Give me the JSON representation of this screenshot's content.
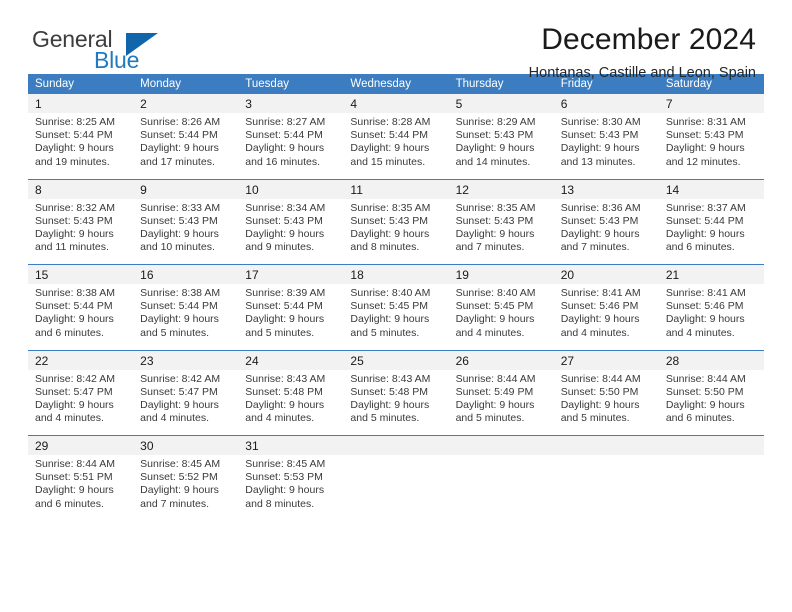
{
  "brand": {
    "name_part1": "General",
    "name_part2": "Blue"
  },
  "header": {
    "title": "December 2024",
    "subtitle": "Hontanas, Castille and Leon, Spain"
  },
  "colors": {
    "header_blue": "#3b7dc0",
    "logo_blue": "#1f7ac0",
    "daynum_bg": "#f2f2f2"
  },
  "weekdays": [
    "Sunday",
    "Monday",
    "Tuesday",
    "Wednesday",
    "Thursday",
    "Friday",
    "Saturday"
  ],
  "weeks": [
    {
      "days": [
        {
          "num": "1",
          "sunrise": "Sunrise: 8:25 AM",
          "sunset": "Sunset: 5:44 PM",
          "daylight1": "Daylight: 9 hours",
          "daylight2": "and 19 minutes."
        },
        {
          "num": "2",
          "sunrise": "Sunrise: 8:26 AM",
          "sunset": "Sunset: 5:44 PM",
          "daylight1": "Daylight: 9 hours",
          "daylight2": "and 17 minutes."
        },
        {
          "num": "3",
          "sunrise": "Sunrise: 8:27 AM",
          "sunset": "Sunset: 5:44 PM",
          "daylight1": "Daylight: 9 hours",
          "daylight2": "and 16 minutes."
        },
        {
          "num": "4",
          "sunrise": "Sunrise: 8:28 AM",
          "sunset": "Sunset: 5:44 PM",
          "daylight1": "Daylight: 9 hours",
          "daylight2": "and 15 minutes."
        },
        {
          "num": "5",
          "sunrise": "Sunrise: 8:29 AM",
          "sunset": "Sunset: 5:43 PM",
          "daylight1": "Daylight: 9 hours",
          "daylight2": "and 14 minutes."
        },
        {
          "num": "6",
          "sunrise": "Sunrise: 8:30 AM",
          "sunset": "Sunset: 5:43 PM",
          "daylight1": "Daylight: 9 hours",
          "daylight2": "and 13 minutes."
        },
        {
          "num": "7",
          "sunrise": "Sunrise: 8:31 AM",
          "sunset": "Sunset: 5:43 PM",
          "daylight1": "Daylight: 9 hours",
          "daylight2": "and 12 minutes."
        }
      ]
    },
    {
      "days": [
        {
          "num": "8",
          "sunrise": "Sunrise: 8:32 AM",
          "sunset": "Sunset: 5:43 PM",
          "daylight1": "Daylight: 9 hours",
          "daylight2": "and 11 minutes."
        },
        {
          "num": "9",
          "sunrise": "Sunrise: 8:33 AM",
          "sunset": "Sunset: 5:43 PM",
          "daylight1": "Daylight: 9 hours",
          "daylight2": "and 10 minutes."
        },
        {
          "num": "10",
          "sunrise": "Sunrise: 8:34 AM",
          "sunset": "Sunset: 5:43 PM",
          "daylight1": "Daylight: 9 hours",
          "daylight2": "and 9 minutes."
        },
        {
          "num": "11",
          "sunrise": "Sunrise: 8:35 AM",
          "sunset": "Sunset: 5:43 PM",
          "daylight1": "Daylight: 9 hours",
          "daylight2": "and 8 minutes."
        },
        {
          "num": "12",
          "sunrise": "Sunrise: 8:35 AM",
          "sunset": "Sunset: 5:43 PM",
          "daylight1": "Daylight: 9 hours",
          "daylight2": "and 7 minutes."
        },
        {
          "num": "13",
          "sunrise": "Sunrise: 8:36 AM",
          "sunset": "Sunset: 5:43 PM",
          "daylight1": "Daylight: 9 hours",
          "daylight2": "and 7 minutes."
        },
        {
          "num": "14",
          "sunrise": "Sunrise: 8:37 AM",
          "sunset": "Sunset: 5:44 PM",
          "daylight1": "Daylight: 9 hours",
          "daylight2": "and 6 minutes."
        }
      ]
    },
    {
      "days": [
        {
          "num": "15",
          "sunrise": "Sunrise: 8:38 AM",
          "sunset": "Sunset: 5:44 PM",
          "daylight1": "Daylight: 9 hours",
          "daylight2": "and 6 minutes."
        },
        {
          "num": "16",
          "sunrise": "Sunrise: 8:38 AM",
          "sunset": "Sunset: 5:44 PM",
          "daylight1": "Daylight: 9 hours",
          "daylight2": "and 5 minutes."
        },
        {
          "num": "17",
          "sunrise": "Sunrise: 8:39 AM",
          "sunset": "Sunset: 5:44 PM",
          "daylight1": "Daylight: 9 hours",
          "daylight2": "and 5 minutes."
        },
        {
          "num": "18",
          "sunrise": "Sunrise: 8:40 AM",
          "sunset": "Sunset: 5:45 PM",
          "daylight1": "Daylight: 9 hours",
          "daylight2": "and 5 minutes."
        },
        {
          "num": "19",
          "sunrise": "Sunrise: 8:40 AM",
          "sunset": "Sunset: 5:45 PM",
          "daylight1": "Daylight: 9 hours",
          "daylight2": "and 4 minutes."
        },
        {
          "num": "20",
          "sunrise": "Sunrise: 8:41 AM",
          "sunset": "Sunset: 5:46 PM",
          "daylight1": "Daylight: 9 hours",
          "daylight2": "and 4 minutes."
        },
        {
          "num": "21",
          "sunrise": "Sunrise: 8:41 AM",
          "sunset": "Sunset: 5:46 PM",
          "daylight1": "Daylight: 9 hours",
          "daylight2": "and 4 minutes."
        }
      ]
    },
    {
      "days": [
        {
          "num": "22",
          "sunrise": "Sunrise: 8:42 AM",
          "sunset": "Sunset: 5:47 PM",
          "daylight1": "Daylight: 9 hours",
          "daylight2": "and 4 minutes."
        },
        {
          "num": "23",
          "sunrise": "Sunrise: 8:42 AM",
          "sunset": "Sunset: 5:47 PM",
          "daylight1": "Daylight: 9 hours",
          "daylight2": "and 4 minutes."
        },
        {
          "num": "24",
          "sunrise": "Sunrise: 8:43 AM",
          "sunset": "Sunset: 5:48 PM",
          "daylight1": "Daylight: 9 hours",
          "daylight2": "and 4 minutes."
        },
        {
          "num": "25",
          "sunrise": "Sunrise: 8:43 AM",
          "sunset": "Sunset: 5:48 PM",
          "daylight1": "Daylight: 9 hours",
          "daylight2": "and 5 minutes."
        },
        {
          "num": "26",
          "sunrise": "Sunrise: 8:44 AM",
          "sunset": "Sunset: 5:49 PM",
          "daylight1": "Daylight: 9 hours",
          "daylight2": "and 5 minutes."
        },
        {
          "num": "27",
          "sunrise": "Sunrise: 8:44 AM",
          "sunset": "Sunset: 5:50 PM",
          "daylight1": "Daylight: 9 hours",
          "daylight2": "and 5 minutes."
        },
        {
          "num": "28",
          "sunrise": "Sunrise: 8:44 AM",
          "sunset": "Sunset: 5:50 PM",
          "daylight1": "Daylight: 9 hours",
          "daylight2": "and 6 minutes."
        }
      ]
    },
    {
      "days": [
        {
          "num": "29",
          "sunrise": "Sunrise: 8:44 AM",
          "sunset": "Sunset: 5:51 PM",
          "daylight1": "Daylight: 9 hours",
          "daylight2": "and 6 minutes."
        },
        {
          "num": "30",
          "sunrise": "Sunrise: 8:45 AM",
          "sunset": "Sunset: 5:52 PM",
          "daylight1": "Daylight: 9 hours",
          "daylight2": "and 7 minutes."
        },
        {
          "num": "31",
          "sunrise": "Sunrise: 8:45 AM",
          "sunset": "Sunset: 5:53 PM",
          "daylight1": "Daylight: 9 hours",
          "daylight2": "and 8 minutes."
        },
        {
          "num": "",
          "sunrise": "",
          "sunset": "",
          "daylight1": "",
          "daylight2": ""
        },
        {
          "num": "",
          "sunrise": "",
          "sunset": "",
          "daylight1": "",
          "daylight2": ""
        },
        {
          "num": "",
          "sunrise": "",
          "sunset": "",
          "daylight1": "",
          "daylight2": ""
        },
        {
          "num": "",
          "sunrise": "",
          "sunset": "",
          "daylight1": "",
          "daylight2": ""
        }
      ]
    }
  ]
}
